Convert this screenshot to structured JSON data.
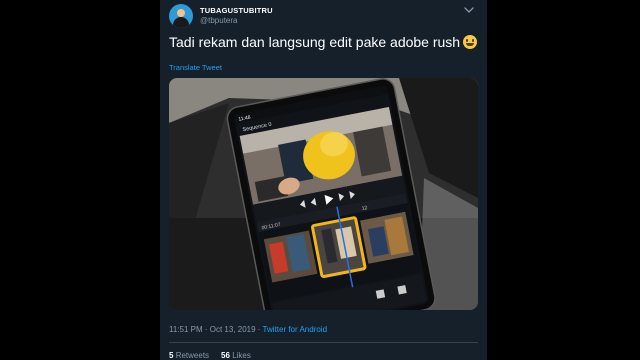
{
  "tweet": {
    "display_name": "TUBAGUSTUBITRU",
    "handle": "@tbputera",
    "text": "Tadi rekam dan langsung edit pake adobe rush",
    "translate_label": "Translate Tweet",
    "time": "11:51 PM",
    "date": "Oct 13, 2019",
    "separator": " · ",
    "source": "Twitter for Android",
    "retweets_count": "5",
    "retweets_label": "Retweets",
    "likes_count": "56",
    "likes_label": "Likes"
  },
  "media": {
    "status_time": "11:46",
    "sequence_title": "Sequence 0",
    "timecode": "00:11:07",
    "timecode_end": "12"
  },
  "icons": {
    "avatar": "avatar",
    "caret": "chevron-down-icon",
    "emoji": "grinning-face-emoji"
  },
  "colors": {
    "background": "#000000",
    "card": "#15202b",
    "text": "#ffffff",
    "muted": "#8899a6",
    "link": "#1da1f2",
    "divider": "#38444d",
    "clip_highlight": "#f2b51c",
    "playhead": "#2b6fe0"
  }
}
